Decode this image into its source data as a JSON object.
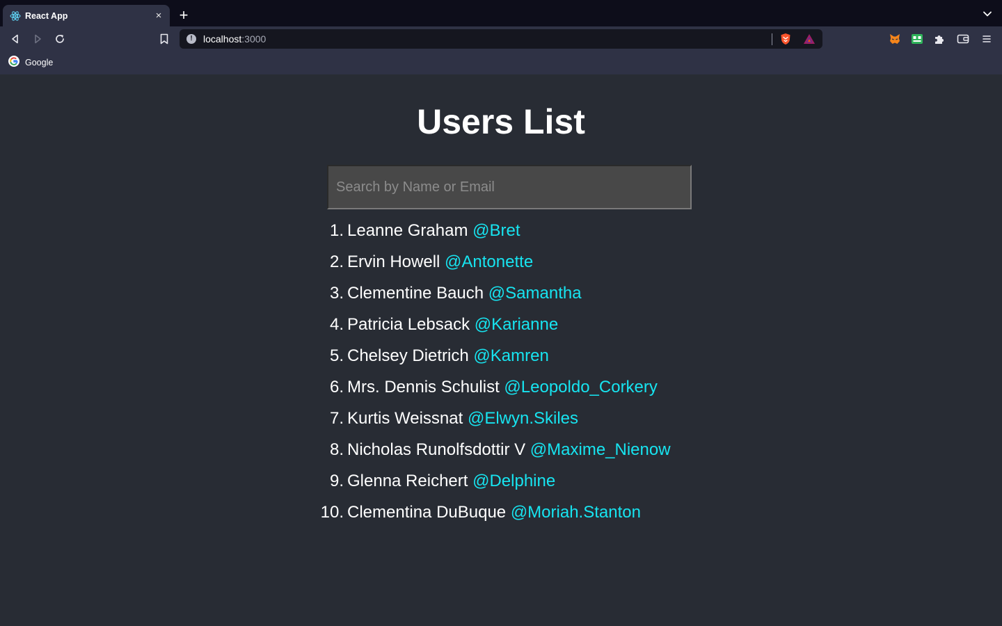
{
  "browser": {
    "tab_title": "React App",
    "tab_close": "×",
    "new_tab": "+",
    "url_host": "localhost",
    "url_port": ":3000",
    "bookmark_label": "Google"
  },
  "page": {
    "title": "Users List",
    "search_placeholder": "Search by Name or Email",
    "search_value": ""
  },
  "users": [
    {
      "num": "1.",
      "name": "Leanne Graham",
      "handle": "@Bret"
    },
    {
      "num": "2.",
      "name": "Ervin Howell",
      "handle": "@Antonette"
    },
    {
      "num": "3.",
      "name": "Clementine Bauch",
      "handle": "@Samantha"
    },
    {
      "num": "4.",
      "name": "Patricia Lebsack",
      "handle": "@Karianne"
    },
    {
      "num": "5.",
      "name": "Chelsey Dietrich",
      "handle": "@Kamren"
    },
    {
      "num": "6.",
      "name": "Mrs. Dennis Schulist",
      "handle": "@Leopoldo_Corkery"
    },
    {
      "num": "7.",
      "name": "Kurtis Weissnat",
      "handle": "@Elwyn.Skiles"
    },
    {
      "num": "8.",
      "name": "Nicholas Runolfsdottir V",
      "handle": "@Maxime_Nienow"
    },
    {
      "num": "9.",
      "name": "Glenna Reichert",
      "handle": "@Delphine"
    },
    {
      "num": "10.",
      "name": "Clementina DuBuque",
      "handle": "@Moriah.Stanton"
    }
  ],
  "icons": {
    "tab_favicon": "react-icon",
    "back": "back-arrow-icon",
    "forward": "forward-arrow-icon",
    "reload": "reload-icon",
    "bookmark": "bookmark-icon",
    "site_info": "info-icon",
    "shields": "brave-shield-icon",
    "rewards": "brave-rewards-icon",
    "ext1": "metamask-fox-icon",
    "ext2": "green-extension-icon",
    "extensions": "puzzle-icon",
    "wallet": "wallet-icon",
    "menu": "hamburger-menu-icon"
  },
  "colors": {
    "page_bg": "#282c34",
    "handle": "#17e4f0",
    "chrome_bg": "#2f3245",
    "tabstrip_bg": "#0d0d1a"
  }
}
